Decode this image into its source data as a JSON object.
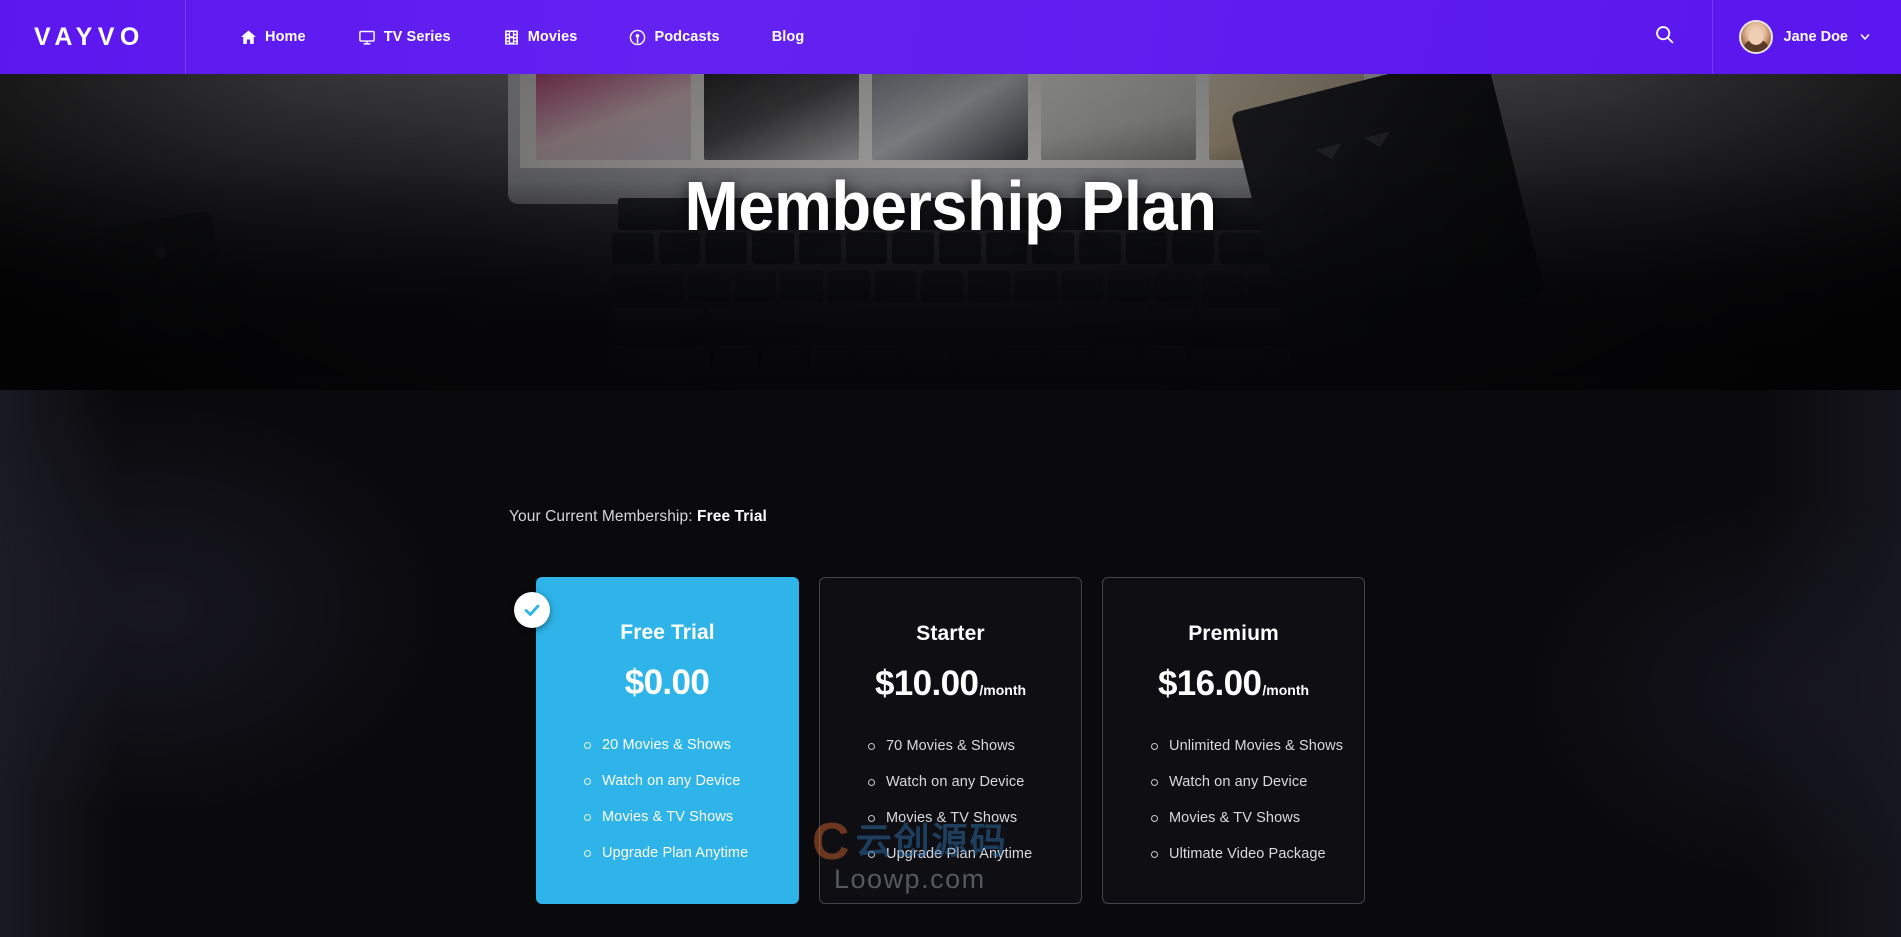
{
  "brand": {
    "logo": "VAYVO"
  },
  "nav": {
    "items": [
      {
        "label": "Home",
        "icon": "home-icon"
      },
      {
        "label": "TV Series",
        "icon": "tv-icon"
      },
      {
        "label": "Movies",
        "icon": "film-icon"
      },
      {
        "label": "Podcasts",
        "icon": "podcast-icon"
      },
      {
        "label": "Blog",
        "icon": null
      }
    ]
  },
  "header_right": {
    "search_icon": "search-icon",
    "user_name": "Jane Doe",
    "caret_icon": "chevron-down-icon",
    "avatar_icon": "user-avatar"
  },
  "hero": {
    "title": "Membership Plan"
  },
  "membership": {
    "label": "Your Current Membership:",
    "current_plan": "Free Trial"
  },
  "plans": [
    {
      "name": "Free Trial",
      "price": "$0.00",
      "period": "",
      "active": true,
      "features": [
        "20 Movies & Shows",
        "Watch on any Device",
        "Movies & TV Shows",
        "Upgrade Plan Anytime"
      ]
    },
    {
      "name": "Starter",
      "price": "$10.00",
      "period": "/month",
      "active": false,
      "features": [
        "70 Movies & Shows",
        "Watch on any Device",
        "Movies & TV Shows",
        "Upgrade Plan Anytime"
      ]
    },
    {
      "name": "Premium",
      "price": "$16.00",
      "period": "/month",
      "active": false,
      "features": [
        "Unlimited Movies & Shows",
        "Watch on any Device",
        "Movies & TV Shows",
        "Ultimate Video Package"
      ]
    }
  ],
  "watermark": {
    "mark": "C",
    "chinese": "云创源码",
    "url": "Loowp.com"
  },
  "colors": {
    "header_purple": "#5d1ced",
    "accent_blue": "#2eb4e8",
    "page_bg": "#0a0a0d",
    "card_border": "#43434c"
  }
}
